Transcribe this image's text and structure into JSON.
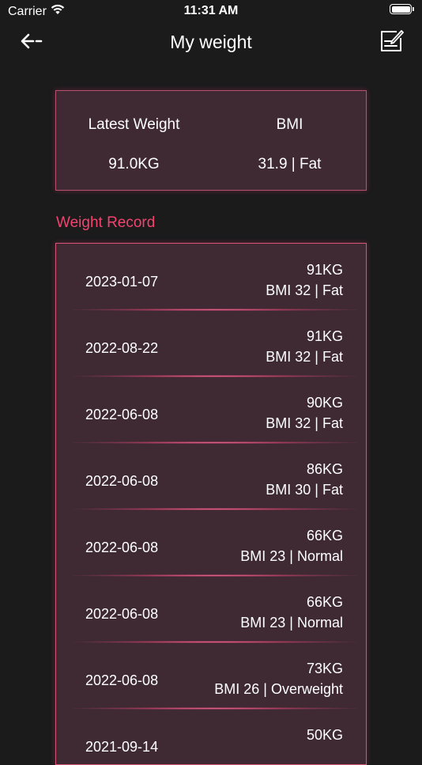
{
  "status_bar": {
    "carrier": "Carrier",
    "time": "11:31 AM"
  },
  "nav": {
    "title": "My weight",
    "back_icon": "back-arrow-icon",
    "edit_icon": "edit-note-icon"
  },
  "summary": {
    "latest_weight_label": "Latest Weight",
    "latest_weight_value": "91.0KG",
    "bmi_label": "BMI",
    "bmi_value": "31.9 | Fat"
  },
  "section": {
    "title": "Weight Record"
  },
  "records": [
    {
      "date": "2023-01-07",
      "weight": "91KG",
      "bmi": "BMI 32 | Fat"
    },
    {
      "date": "2022-08-22",
      "weight": "91KG",
      "bmi": "BMI 32 | Fat"
    },
    {
      "date": "2022-06-08",
      "weight": "90KG",
      "bmi": "BMI 32 | Fat"
    },
    {
      "date": "2022-06-08",
      "weight": "86KG",
      "bmi": "BMI 30 | Fat"
    },
    {
      "date": "2022-06-08",
      "weight": "66KG",
      "bmi": "BMI 23 | Normal"
    },
    {
      "date": "2022-06-08",
      "weight": "66KG",
      "bmi": "BMI 23 | Normal"
    },
    {
      "date": "2022-06-08",
      "weight": "73KG",
      "bmi": "BMI 26 | Overweight"
    },
    {
      "date": "2021-09-14",
      "weight": "50KG",
      "bmi": ""
    }
  ],
  "colors": {
    "background": "#1b1b1c",
    "card": "#3f2a33",
    "accent": "#f2436f"
  }
}
